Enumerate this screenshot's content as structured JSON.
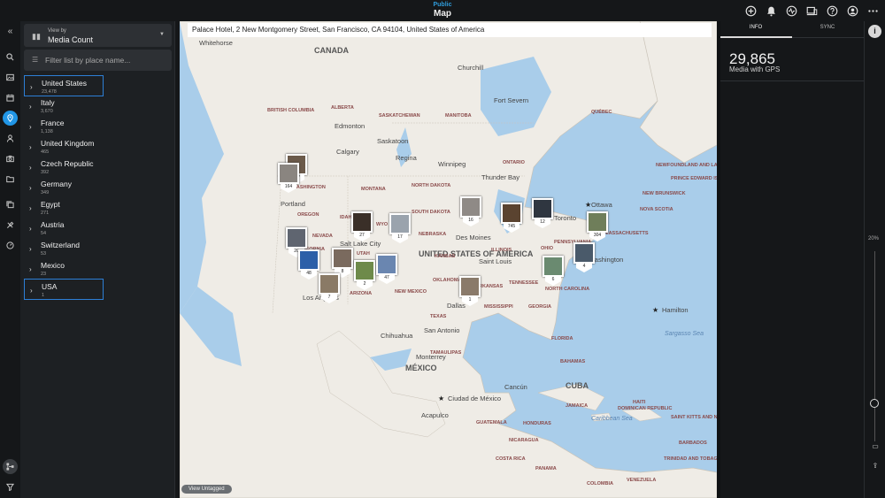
{
  "header": {
    "subtitle": "Public",
    "title": "Map"
  },
  "top_icons": [
    "plus-circle-icon",
    "bell-icon",
    "activity-icon",
    "devices-icon",
    "help-icon",
    "account-icon",
    "more-icon"
  ],
  "sidebar": {
    "view_by_label": "View by",
    "view_by_value": "Media Count",
    "filter_placeholder": "Filter list by place name...",
    "countries": [
      {
        "name": "United States",
        "count": "23,478"
      },
      {
        "name": "Italy",
        "count": "3,670"
      },
      {
        "name": "France",
        "count": "1,138"
      },
      {
        "name": "United Kingdom",
        "count": "465"
      },
      {
        "name": "Czech Republic",
        "count": "392"
      },
      {
        "name": "Germany",
        "count": "349"
      },
      {
        "name": "Egypt",
        "count": "271"
      },
      {
        "name": "Austria",
        "count": "54"
      },
      {
        "name": "Switzerland",
        "count": "53"
      },
      {
        "name": "Mexico",
        "count": "23"
      },
      {
        "name": "USA",
        "count": "1"
      }
    ]
  },
  "map": {
    "address": "Palace Hotel, 2 New Montgomery Street, San Francisco, CA 94104, United States of America",
    "view_untagged": "View Untagged",
    "labels": {
      "whitehorse": "Whitehorse",
      "canada": "CANADA",
      "churchill": "Churchill",
      "fort_severn": "Fort Severn",
      "bc": "BRITISH COLUMBIA",
      "alberta": "ALBERTA",
      "sask": "SASKATCHEWAN",
      "manitoba": "MANITOBA",
      "ontario": "ONTARIO",
      "quebec": "QUÉBEC",
      "edmonton": "Edmonton",
      "saskatoon": "Saskatoon",
      "calgary": "Calgary",
      "regina": "Regina",
      "winnipeg": "Winnipeg",
      "thunder_bay": "Thunder Bay",
      "nl": "NEWFOUNDLAND AND LABRADOR",
      "pei": "PRINCE EDWARD ISLAND",
      "nb": "NEW BRUNSWICK",
      "ns": "NOVA SCOTIA",
      "washington": "WASHINGTON",
      "portland": "Portland",
      "oregon": "OREGON",
      "montana": "MONTANA",
      "north_dakota": "NORTH DAKOTA",
      "south_dakota": "SOUTH DAKOTA",
      "idaho": "IDAHO",
      "wyoming": "WYO",
      "salt_lake": "Salt Lake City",
      "utah": "UTAH",
      "arizona": "ARIZONA",
      "new_mexico": "NEW MEXICO",
      "des_moines": "Des Moines",
      "illinois": "ILLINOIS",
      "saint_louis": "Saint Louis",
      "ottawa": "Ottawa",
      "toronto": "Toronto",
      "usa": "UNITED STATES OF AMERICA",
      "ohio": "OHIO",
      "washington_dc": "Washington",
      "tennessee": "TENNESSEE",
      "n_carolina": "NORTH CAROLINA",
      "kansas": "KANSAS",
      "dallas": "Dallas",
      "texas": "TEXAS",
      "mississippi": "MISSISSIPPI",
      "georgia": "GEORGIA",
      "san_antonio": "San Antonio",
      "florida": "FLORIDA",
      "chihuahua": "Chihuahua",
      "monterrey": "Monterrey",
      "mexico": "MÉXICO",
      "ciudad": "Ciudad de México",
      "acapulco": "Acapulco",
      "cancun": "Cancún",
      "cuba": "CUBA",
      "bahamas": "BAHAMAS",
      "hamilton": "Hamilton",
      "sargasso": "Sargasso Sea",
      "haiti": "HAITI",
      "jamaica": "JAMAICA",
      "caribbean": "Caribbean Sea",
      "guatemala": "GUATEMALA",
      "nicaragua": "NICARAGUA",
      "honduras": "HONDURAS",
      "costa_rica": "COSTA RICA",
      "panama": "PANAMA",
      "colombia": "COLOMBIA",
      "venezuela": "VENEZUELA",
      "trinidad": "TRINIDAD AND TOBAGO",
      "barbados": "BARBADOS",
      "kitts": "SAINT KITTS AND NEVIS",
      "dominican": "DOMINICAN REPUBLIC",
      "massachusetts": "MASSACHUSETTS",
      "pennsylvania": "PENNSYLVANIA",
      "los_angeles": "Los Angeles",
      "california": "CALIFORNIA",
      "nevada": "NEVADA",
      "nebraska": "NEBRASKA",
      "oklahoma": "OKLAHOMA",
      "arkansas": "ARKANSAS",
      "tamaulipas": "TAMAULIPAS"
    },
    "pins": [
      {
        "count": "127",
        "color": "#6b5a4a"
      },
      {
        "count": "164",
        "color": "#8a8580"
      },
      {
        "count": "27",
        "color": "#3a2f28"
      },
      {
        "count": "17",
        "color": "#9aa3ad"
      },
      {
        "count": "16",
        "color": "#8f8a86"
      },
      {
        "count": "745",
        "color": "#5a4330"
      },
      {
        "count": "12",
        "color": "#2f3640"
      },
      {
        "count": "304",
        "color": "#6f7e5a"
      },
      {
        "count": "20",
        "color": "#5f6570"
      },
      {
        "count": "48",
        "color": "#2c5fa8"
      },
      {
        "count": "8",
        "color": "#7a6a5e"
      },
      {
        "count": "2",
        "color": "#6e8a4a"
      },
      {
        "count": "7",
        "color": "#8a7a66"
      },
      {
        "count": "47",
        "color": "#6a86b0"
      },
      {
        "count": "1",
        "color": "#8a7a6a"
      },
      {
        "count": "6",
        "color": "#6a8a70"
      },
      {
        "count": "4",
        "color": "#4a5a6a"
      }
    ]
  },
  "info": {
    "tab_info": "INFO",
    "tab_sync": "SYNC",
    "count": "29,865",
    "label": "Media with GPS"
  },
  "zoom": {
    "label": "20%",
    "level": 0.2
  },
  "colors": {
    "accent": "#2196e6",
    "highlight_border": "#2d7fd6",
    "map_water": "#a9cdea",
    "map_land": "#efece6"
  }
}
